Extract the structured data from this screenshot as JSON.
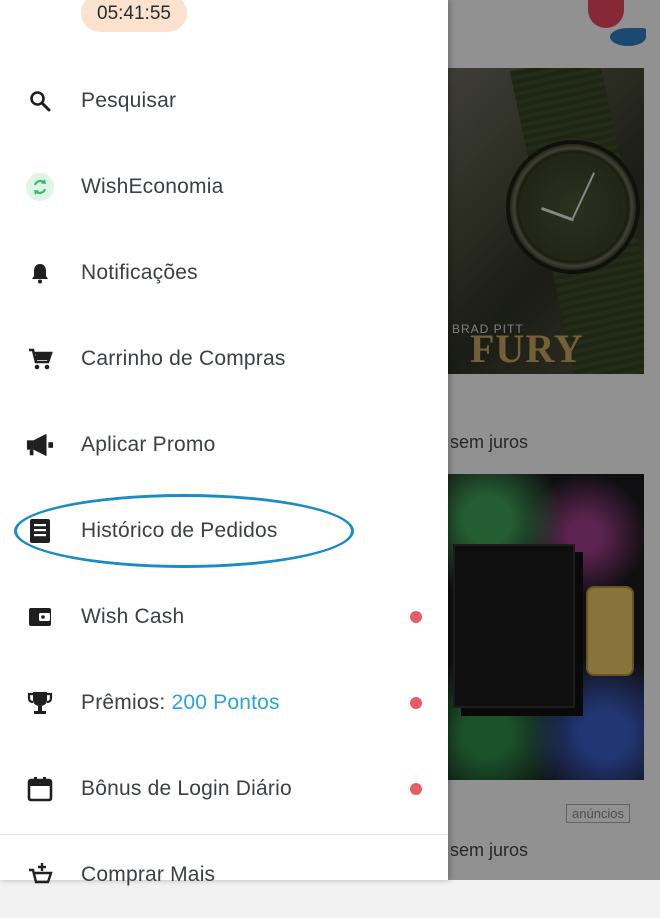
{
  "timer": "05:41:55",
  "menu": [
    {
      "label": "Pesquisar",
      "icon": "search-icon",
      "dot": false
    },
    {
      "label": "WishEconomia",
      "icon": "refresh-circle-icon",
      "dot": false
    },
    {
      "label": "Notificações",
      "icon": "bell-icon",
      "dot": false
    },
    {
      "label": "Carrinho de Compras",
      "icon": "cart-icon",
      "dot": false
    },
    {
      "label": "Aplicar Promo",
      "icon": "megaphone-icon",
      "dot": false
    },
    {
      "label": "Histórico de Pedidos",
      "icon": "receipt-icon",
      "dot": false
    },
    {
      "label": "Wish Cash",
      "icon": "wallet-icon",
      "dot": true
    },
    {
      "label": "Prêmios: ",
      "points": "200 Pontos",
      "icon": "trophy-icon",
      "dot": true
    },
    {
      "label": "Bônus de Login Diário",
      "icon": "calendar-icon",
      "dot": true
    },
    {
      "label": "Comprar Mais",
      "icon": "cart-plus-icon",
      "dot": false
    }
  ],
  "background": {
    "movie_brand": "BRAD PITT",
    "movie_title": "FURY",
    "installments_1": "sem juros",
    "installments_2": "sem juros",
    "ad_badge": "anúncios"
  },
  "colors": {
    "accent_points": "#2aa3d8",
    "notification_dot": "#e85c68",
    "highlight_ring": "#1a8bc4",
    "timer_bg": "#fbe2cf"
  }
}
